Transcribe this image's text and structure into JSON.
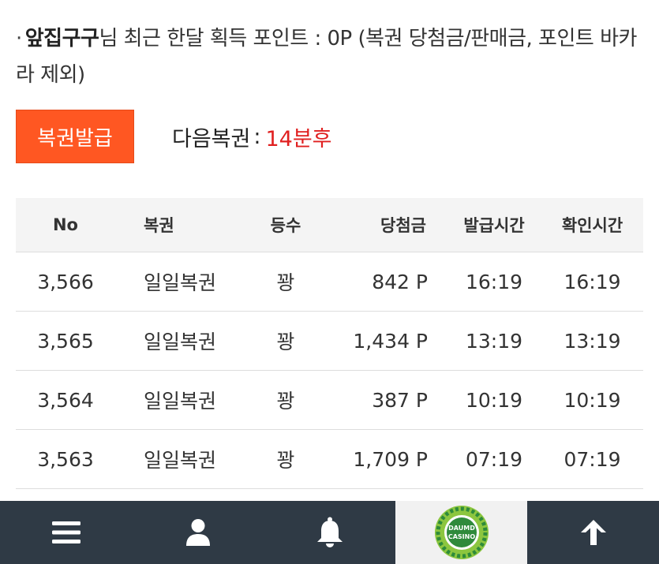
{
  "info": {
    "bullet": "·",
    "username": "앞집구구",
    "text": "님 최근 한달 획득 포인트 : 0P (복권 당첨금/판매금, 포인트 바카라 제외)"
  },
  "issue": {
    "button_label": "복권발급",
    "next_label": "다음복권",
    "colon": ":",
    "next_time": "14분후",
    "accent_color": "#ff5722",
    "time_color": "#e02020"
  },
  "table": {
    "headers": {
      "no": "No",
      "name": "복권",
      "rank": "등수",
      "prize": "당첨금",
      "issued": "발급시간",
      "checked": "확인시간"
    },
    "rows": [
      {
        "no": "3,566",
        "name": "일일복권",
        "rank": "꽝",
        "prize": "842 P",
        "issued": "16:19",
        "checked": "16:19"
      },
      {
        "no": "3,565",
        "name": "일일복권",
        "rank": "꽝",
        "prize": "1,434 P",
        "issued": "13:19",
        "checked": "13:19"
      },
      {
        "no": "3,564",
        "name": "일일복권",
        "rank": "꽝",
        "prize": "387 P",
        "issued": "10:19",
        "checked": "10:19"
      },
      {
        "no": "3,563",
        "name": "일일복권",
        "rank": "꽝",
        "prize": "1,709 P",
        "issued": "07:19",
        "checked": "07:19"
      }
    ]
  },
  "nav": {
    "items": [
      {
        "icon": "menu-icon"
      },
      {
        "icon": "user-icon"
      },
      {
        "icon": "bell-icon"
      },
      {
        "icon": "casino-logo",
        "logo_line1": "DAUMD",
        "logo_line2": "CASINO"
      },
      {
        "icon": "arrow-up-icon"
      }
    ],
    "background": "#2f3a45",
    "logo_background": "#f1f1f1"
  }
}
